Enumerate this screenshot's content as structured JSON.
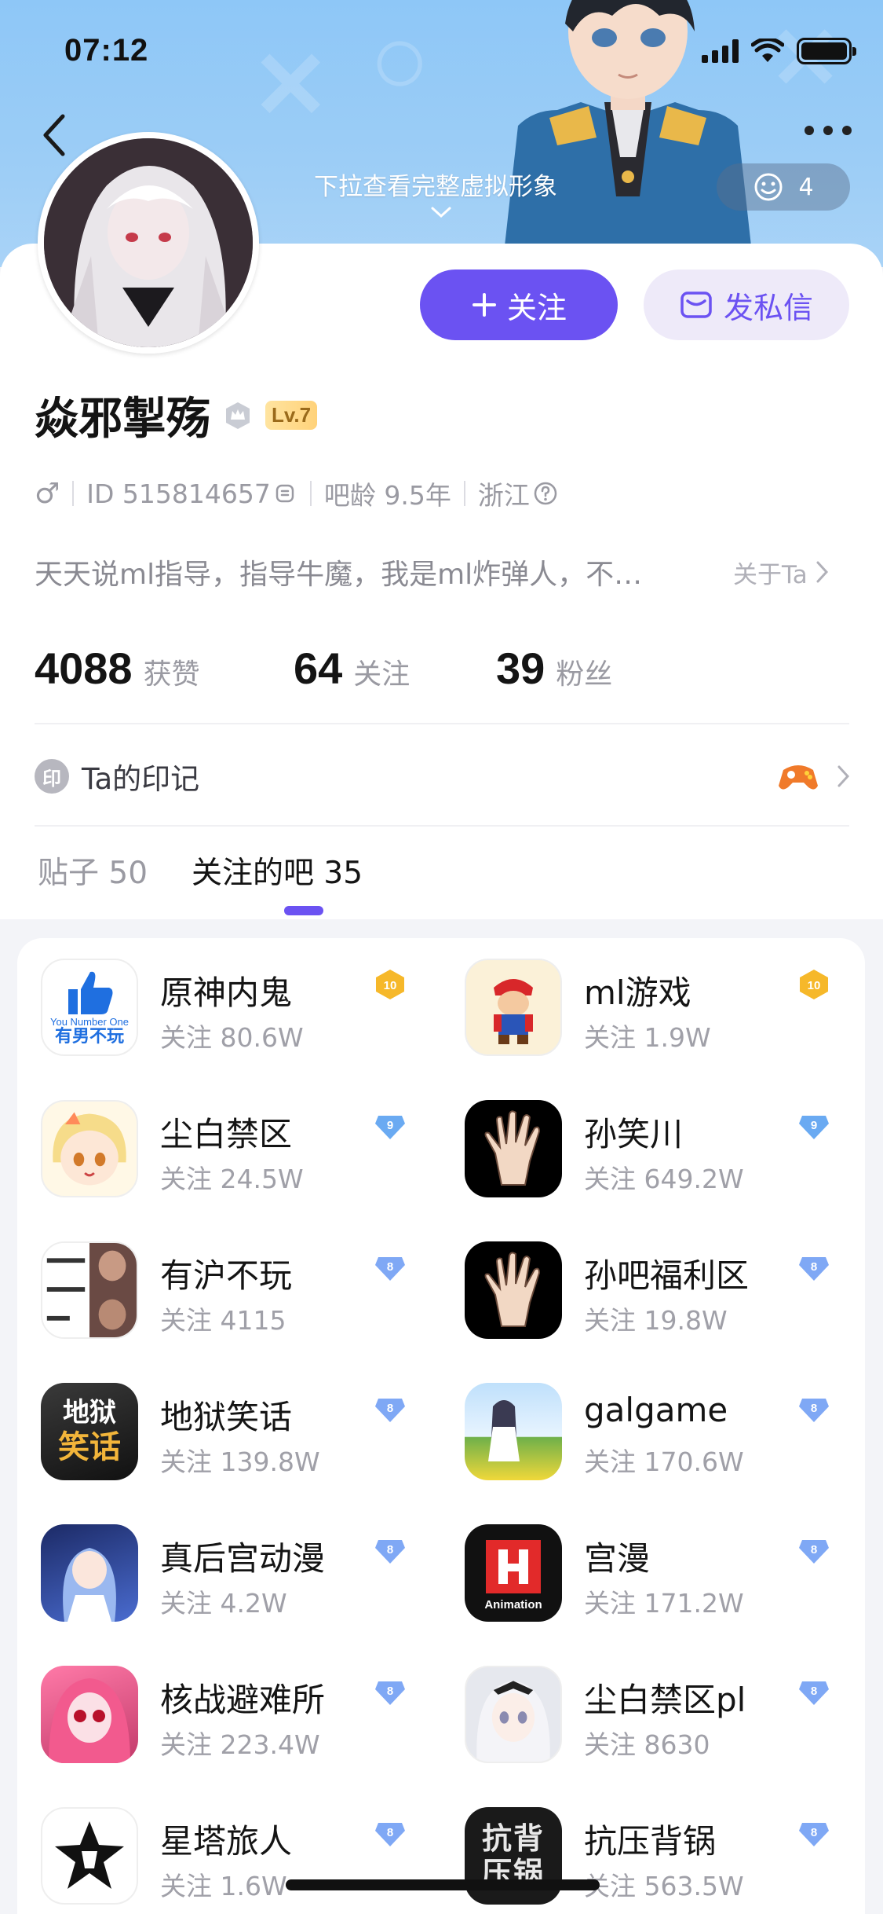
{
  "status_bar": {
    "time": "07:12"
  },
  "header": {
    "pull_hint": "下拉查看完整虚拟形象",
    "visitor_count": "4"
  },
  "profile": {
    "username": "焱邪掣殇",
    "level": "Lv.7",
    "gender_symbol": "♂",
    "id_text": "ID 515814657",
    "tieba_age": "吧龄 9.5年",
    "location": "浙江",
    "bio": "天天说ml指导，指导牛魔，我是ml炸弹人，不…",
    "about_link": "关于Ta"
  },
  "actions": {
    "follow_label": "关注",
    "dm_label": "发私信"
  },
  "stats": [
    {
      "value": "4088",
      "label": "获赞"
    },
    {
      "value": "64",
      "label": "关注"
    },
    {
      "value": "39",
      "label": "粉丝"
    }
  ],
  "seal": {
    "icon_char": "印",
    "label": "Ta的印记"
  },
  "tabs": [
    {
      "label": "贴子 50"
    },
    {
      "label": "关注的吧 35"
    }
  ],
  "bars": [
    {
      "name": "原神内鬼",
      "followers": "关注 80.6W",
      "level": "10",
      "level_color": "#f6b82a",
      "icon": "thumbs-up-icon",
      "icon_text_1": "You Number One",
      "icon_text_2": "有男不玩"
    },
    {
      "name": "ml游戏",
      "followers": "关注 1.9W",
      "level": "10",
      "level_color": "#f6b82a",
      "icon": "mario-icon"
    },
    {
      "name": "尘白禁区",
      "followers": "关注 24.5W",
      "level": "9",
      "level_color": "#6aaaf2",
      "icon": "anime-girl-blonde-icon"
    },
    {
      "name": "孙笑川",
      "followers": "关注 649.2W",
      "level": "9",
      "level_color": "#6aaaf2",
      "icon": "hand-icon"
    },
    {
      "name": "有沪不玩",
      "followers": "关注 4115",
      "level": "8",
      "level_color": "#7fa8f5",
      "icon": "meme-collage-icon"
    },
    {
      "name": "孙吧福利区",
      "followers": "关注 19.8W",
      "level": "8",
      "level_color": "#7fa8f5",
      "icon": "hand-icon"
    },
    {
      "name": "地狱笑话",
      "followers": "关注 139.8W",
      "level": "8",
      "level_color": "#7fa8f5",
      "icon": "hell-jokes-icon",
      "icon_text_1": "地狱",
      "icon_text_2": "笑话"
    },
    {
      "name": "galgame",
      "followers": "关注 170.6W",
      "level": "8",
      "level_color": "#7fa8f5",
      "icon": "galgame-scene-icon"
    },
    {
      "name": "真后宫动漫",
      "followers": "关注 4.2W",
      "level": "8",
      "level_color": "#7fa8f5",
      "icon": "anime-girl-blue-icon"
    },
    {
      "name": "宫漫",
      "followers": "关注 171.2W",
      "level": "8",
      "level_color": "#7fa8f5",
      "icon": "h-animation-icon",
      "icon_text_1": "Animation"
    },
    {
      "name": "核战避难所",
      "followers": "关注 223.4W",
      "level": "8",
      "level_color": "#7fa8f5",
      "icon": "anime-girl-pink-icon"
    },
    {
      "name": "尘白禁区pl",
      "followers": "关注 8630",
      "level": "8",
      "level_color": "#7fa8f5",
      "icon": "anime-girl-silver-icon"
    },
    {
      "name": "星塔旅人",
      "followers": "关注 1.6W",
      "level": "8",
      "level_color": "#7fa8f5",
      "icon": "star-tower-logo-icon"
    },
    {
      "name": "抗压背锅",
      "followers": "关注 563.5W",
      "level": "8",
      "level_color": "#7fa8f5",
      "icon": "pressure-text-icon",
      "icon_text_1": "抗背",
      "icon_text_2": "压锅"
    }
  ],
  "colors": {
    "accent": "#6b52f2",
    "banner": "#9ccdf6"
  }
}
